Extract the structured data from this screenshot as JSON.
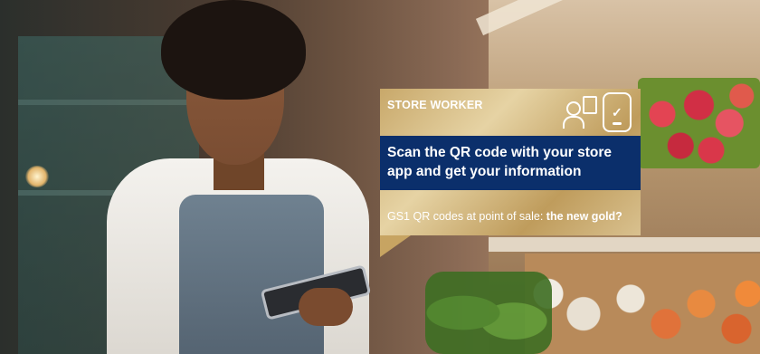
{
  "banner": {
    "tag": "STORE WORKER",
    "headline": "Scan the QR code with your store app and get your information",
    "subline_intro": "GS1 QR codes at point of sale: ",
    "subline_emphasis": "the new gold?",
    "icons": [
      "store-worker-icon",
      "phone-scan-icon"
    ],
    "colors": {
      "gold": "#c8a86a",
      "navy": "#0b2f6b",
      "text": "#ffffff"
    }
  }
}
